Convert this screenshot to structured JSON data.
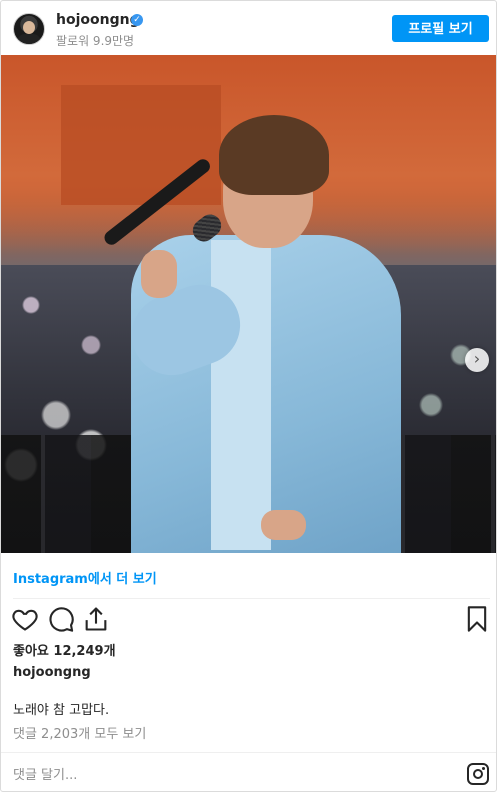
{
  "header": {
    "username": "hojoongng",
    "verified_icon": "verified-badge-icon",
    "followers": "팔로워 9.9만명",
    "profile_button": "프로필 보기"
  },
  "photo": {
    "carousel_count": 3,
    "active_index": 0,
    "next_icon": "chevron-right-icon"
  },
  "more_link": {
    "brand": "Instagram",
    "suffix": "에서 더 보기"
  },
  "actions": {
    "like_icon": "heart-icon",
    "comment_icon": "comment-icon",
    "share_icon": "share-icon",
    "save_icon": "bookmark-icon"
  },
  "likes": "좋아요 12,249개",
  "post": {
    "username": "hojoongng",
    "caption": "노래야 참 고맙다.",
    "view_comments": "댓글 2,203개 모두 보기"
  },
  "comment": {
    "placeholder": "댓글 달기...",
    "instagram_icon": "instagram-logo-icon"
  },
  "colors": {
    "accent": "#0095f6",
    "link": "#00376b",
    "muted": "#8e8e8e"
  }
}
